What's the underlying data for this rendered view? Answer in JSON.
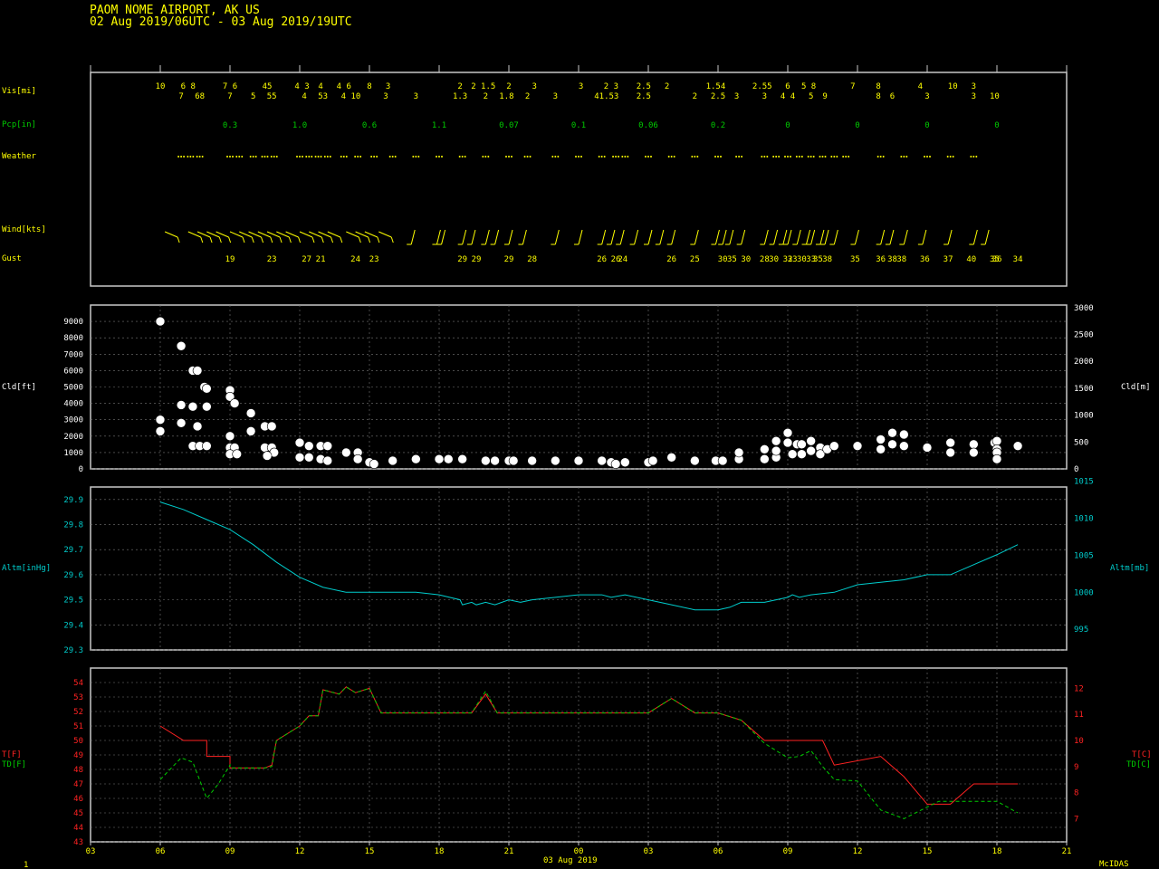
{
  "header": {
    "title": "PAOM  NOME AIRPORT, AK US",
    "subtitle": "02 Aug 2019/06UTC - 03 Aug 2019/19UTC"
  },
  "footer": {
    "page": "1",
    "brand": "McIDAS",
    "date_label": "03 Aug 2019"
  },
  "colors": {
    "yellow": "#ffff00",
    "green": "#00cc00",
    "cyan": "#00cccc",
    "red": "#ff2222",
    "white": "#ffffff",
    "grid": "#777777",
    "frame": "#c8c8c8"
  },
  "labels": {
    "vis": "Vis[mi]",
    "pcp": "Pcp[in]",
    "weather": "Weather",
    "wind": "Wind[kts]",
    "gust": "Gust",
    "cld_ft": "Cld[ft]",
    "cld_m": "Cld[m]",
    "altm_inhg": "Altm[inHg]",
    "altm_mb": "Altm[mb]",
    "t_f": "T[F]",
    "td_f": "TD[F]",
    "t_c": "T[C]",
    "td_c": "TD[C]"
  },
  "chart_data": {
    "type": "line",
    "x_unit": "hours since 02 Aug 2019 03UTC",
    "x_range": [
      0,
      42
    ],
    "x_ticks": [
      "03",
      "06",
      "09",
      "12",
      "15",
      "18",
      "21",
      "00",
      "03",
      "06",
      "09",
      "12",
      "15",
      "18",
      "21"
    ],
    "vis_top": [
      {
        "t": 3,
        "v": "10"
      },
      {
        "t": 4.2,
        "v": "6 8"
      },
      {
        "t": 6.0,
        "v": "7 6"
      },
      {
        "t": 7.6,
        "v": "45"
      },
      {
        "t": 9.1,
        "v": "4 3"
      },
      {
        "t": 9.9,
        "v": "4"
      },
      {
        "t": 10.9,
        "v": "4 6"
      },
      {
        "t": 12.0,
        "v": "8"
      },
      {
        "t": 12.8,
        "v": "3"
      },
      {
        "t": 15.9,
        "v": "2"
      },
      {
        "t": 16.9,
        "v": "2 1.5"
      },
      {
        "t": 18.0,
        "v": "2"
      },
      {
        "t": 19.1,
        "v": "3"
      },
      {
        "t": 21.1,
        "v": "3"
      },
      {
        "t": 22.4,
        "v": "2 3"
      },
      {
        "t": 23.8,
        "v": "2.5"
      },
      {
        "t": 24.8,
        "v": "2"
      },
      {
        "t": 26.9,
        "v": "1.54"
      },
      {
        "t": 28.9,
        "v": "2.55"
      },
      {
        "t": 30.0,
        "v": "6"
      },
      {
        "t": 30.9,
        "v": "5 8"
      },
      {
        "t": 32.8,
        "v": "7"
      },
      {
        "t": 33.9,
        "v": "8"
      },
      {
        "t": 35.7,
        "v": "4"
      },
      {
        "t": 37.1,
        "v": "10"
      },
      {
        "t": 38.0,
        "v": "3"
      }
    ],
    "vis_bottom": [
      {
        "t": 3.9,
        "v": "7"
      },
      {
        "t": 4.7,
        "v": "68"
      },
      {
        "t": 6.0,
        "v": "7"
      },
      {
        "t": 7.0,
        "v": "5"
      },
      {
        "t": 7.8,
        "v": "55"
      },
      {
        "t": 9.2,
        "v": "4"
      },
      {
        "t": 10.0,
        "v": "53"
      },
      {
        "t": 11.2,
        "v": "4 10"
      },
      {
        "t": 12.7,
        "v": "3"
      },
      {
        "t": 14.0,
        "v": "3"
      },
      {
        "t": 15.9,
        "v": "1.3"
      },
      {
        "t": 17.0,
        "v": "2"
      },
      {
        "t": 17.9,
        "v": "1.8"
      },
      {
        "t": 18.8,
        "v": "2"
      },
      {
        "t": 20.0,
        "v": "3"
      },
      {
        "t": 22.2,
        "v": "41.53"
      },
      {
        "t": 23.8,
        "v": "2.5"
      },
      {
        "t": 26.0,
        "v": "2"
      },
      {
        "t": 27.0,
        "v": "2.5"
      },
      {
        "t": 27.8,
        "v": "3"
      },
      {
        "t": 29.0,
        "v": "3"
      },
      {
        "t": 30.0,
        "v": "4 4"
      },
      {
        "t": 31.0,
        "v": "5"
      },
      {
        "t": 31.6,
        "v": "9"
      },
      {
        "t": 33.9,
        "v": "8"
      },
      {
        "t": 34.5,
        "v": "6"
      },
      {
        "t": 36.0,
        "v": "3"
      },
      {
        "t": 38.0,
        "v": "3"
      },
      {
        "t": 38.9,
        "v": "10"
      }
    ],
    "precip": [
      {
        "t": 6.0,
        "v": "0.3"
      },
      {
        "t": 9.0,
        "v": "1.0"
      },
      {
        "t": 12.0,
        "v": "0.6"
      },
      {
        "t": 15.0,
        "v": "1.1"
      },
      {
        "t": 18.0,
        "v": "0.07"
      },
      {
        "t": 21.0,
        "v": "0.1"
      },
      {
        "t": 24.0,
        "v": "0.06"
      },
      {
        "t": 27.0,
        "v": "0.2"
      },
      {
        "t": 30.0,
        "v": "0"
      },
      {
        "t": 33.0,
        "v": "0"
      },
      {
        "t": 36.0,
        "v": "0"
      },
      {
        "t": 39.0,
        "v": "0"
      }
    ],
    "weather_times": [
      3.9,
      4.3,
      4.7,
      6.0,
      6.4,
      7.0,
      7.5,
      7.9,
      9.0,
      9.4,
      9.8,
      10.2,
      10.9,
      11.5,
      12.2,
      13.0,
      14.0,
      15.0,
      16.0,
      17.0,
      18.0,
      18.8,
      20.0,
      21.0,
      22.0,
      22.6,
      23.0,
      24.0,
      25.0,
      26.0,
      27.0,
      27.9,
      29.0,
      29.5,
      30.0,
      30.5,
      31.0,
      31.5,
      32.0,
      32.5,
      34.0,
      35.0,
      36.0,
      37.0,
      38.0
    ],
    "wind_times": [
      3.2,
      4.2,
      4.6,
      5.0,
      5.4,
      6.0,
      6.4,
      6.8,
      7.2,
      7.6,
      8.0,
      8.4,
      9.0,
      9.4,
      9.8,
      10.2,
      11.0,
      11.4,
      11.8,
      12.4,
      13.8,
      14.9,
      15.1,
      16.0,
      16.4,
      17.0,
      17.4,
      18.0,
      18.6,
      20.0,
      21.0,
      22.0,
      22.4,
      22.8,
      23.4,
      24.0,
      24.5,
      25.0,
      26.0,
      26.9,
      27.2,
      27.5,
      28.0,
      29.0,
      29.4,
      29.8,
      30.0,
      30.4,
      30.8,
      31.0,
      31.4,
      31.6,
      32.0,
      32.9,
      34.0,
      34.4,
      35.0,
      35.8,
      36.9,
      38.0,
      38.5
    ],
    "gust": [
      {
        "t": 6.0,
        "v": "19"
      },
      {
        "t": 7.8,
        "v": "23"
      },
      {
        "t": 9.3,
        "v": "27"
      },
      {
        "t": 9.9,
        "v": "21"
      },
      {
        "t": 11.4,
        "v": "24"
      },
      {
        "t": 12.2,
        "v": "23"
      },
      {
        "t": 16.0,
        "v": "29"
      },
      {
        "t": 16.6,
        "v": "29"
      },
      {
        "t": 18.0,
        "v": "29"
      },
      {
        "t": 19.0,
        "v": "28"
      },
      {
        "t": 22.0,
        "v": "26"
      },
      {
        "t": 22.6,
        "v": "26"
      },
      {
        "t": 22.9,
        "v": "24"
      },
      {
        "t": 25.0,
        "v": "26"
      },
      {
        "t": 26.0,
        "v": "25"
      },
      {
        "t": 27.2,
        "v": "30"
      },
      {
        "t": 27.6,
        "v": "35"
      },
      {
        "t": 28.2,
        "v": "30"
      },
      {
        "t": 29.0,
        "v": "28"
      },
      {
        "t": 29.4,
        "v": "30"
      },
      {
        "t": 30.0,
        "v": "32"
      },
      {
        "t": 30.2,
        "v": "33"
      },
      {
        "t": 30.6,
        "v": "30"
      },
      {
        "t": 31.0,
        "v": "33"
      },
      {
        "t": 31.3,
        "v": "35"
      },
      {
        "t": 31.7,
        "v": "38"
      },
      {
        "t": 32.9,
        "v": "35"
      },
      {
        "t": 34.0,
        "v": "36"
      },
      {
        "t": 34.5,
        "v": "38"
      },
      {
        "t": 34.9,
        "v": "38"
      },
      {
        "t": 35.9,
        "v": "36"
      },
      {
        "t": 36.9,
        "v": "37"
      },
      {
        "t": 37.9,
        "v": "40"
      },
      {
        "t": 38.9,
        "v": "35"
      },
      {
        "t": 39.0,
        "v": "36"
      },
      {
        "t": 39.9,
        "v": "34"
      }
    ],
    "cloud": {
      "y_range_ft": [
        0,
        10000
      ],
      "y_ticks_ft": [
        0,
        1000,
        2000,
        3000,
        4000,
        5000,
        6000,
        7000,
        8000,
        9000
      ],
      "y_ticks_m": [
        0,
        500,
        1000,
        1500,
        2000,
        2500,
        3000
      ],
      "points": [
        {
          "t": 3.0,
          "v": 9000
        },
        {
          "t": 3.0,
          "v": 3000
        },
        {
          "t": 3.0,
          "v": 2300
        },
        {
          "t": 3.9,
          "v": 7500
        },
        {
          "t": 3.9,
          "v": 3900
        },
        {
          "t": 3.9,
          "v": 2800
        },
        {
          "t": 4.4,
          "v": 6000
        },
        {
          "t": 4.6,
          "v": 6000
        },
        {
          "t": 4.4,
          "v": 3800
        },
        {
          "t": 4.6,
          "v": 2600
        },
        {
          "t": 4.4,
          "v": 1400
        },
        {
          "t": 4.7,
          "v": 1400
        },
        {
          "t": 4.9,
          "v": 5000
        },
        {
          "t": 5.0,
          "v": 4900
        },
        {
          "t": 5.0,
          "v": 3800
        },
        {
          "t": 5.0,
          "v": 1400
        },
        {
          "t": 6.0,
          "v": 4800
        },
        {
          "t": 6.0,
          "v": 4400
        },
        {
          "t": 6.0,
          "v": 2000
        },
        {
          "t": 6.0,
          "v": 1300
        },
        {
          "t": 6.2,
          "v": 4000
        },
        {
          "t": 6.2,
          "v": 1300
        },
        {
          "t": 6.0,
          "v": 900
        },
        {
          "t": 6.3,
          "v": 900
        },
        {
          "t": 6.9,
          "v": 3400
        },
        {
          "t": 6.9,
          "v": 2300
        },
        {
          "t": 7.5,
          "v": 2600
        },
        {
          "t": 7.8,
          "v": 2600
        },
        {
          "t": 7.5,
          "v": 1300
        },
        {
          "t": 7.8,
          "v": 1300
        },
        {
          "t": 7.9,
          "v": 1000
        },
        {
          "t": 7.6,
          "v": 800
        },
        {
          "t": 9.0,
          "v": 1600
        },
        {
          "t": 9.0,
          "v": 700
        },
        {
          "t": 9.4,
          "v": 1400
        },
        {
          "t": 9.4,
          "v": 700
        },
        {
          "t": 9.9,
          "v": 1400
        },
        {
          "t": 10.2,
          "v": 1400
        },
        {
          "t": 9.9,
          "v": 600
        },
        {
          "t": 10.2,
          "v": 500
        },
        {
          "t": 11.0,
          "v": 1000
        },
        {
          "t": 11.5,
          "v": 1000
        },
        {
          "t": 11.5,
          "v": 600
        },
        {
          "t": 12.0,
          "v": 400
        },
        {
          "t": 12.2,
          "v": 300
        },
        {
          "t": 13.0,
          "v": 500
        },
        {
          "t": 14.0,
          "v": 600
        },
        {
          "t": 15.0,
          "v": 600
        },
        {
          "t": 15.4,
          "v": 600
        },
        {
          "t": 16.0,
          "v": 600
        },
        {
          "t": 17.0,
          "v": 500
        },
        {
          "t": 17.4,
          "v": 500
        },
        {
          "t": 18.0,
          "v": 500
        },
        {
          "t": 18.2,
          "v": 500
        },
        {
          "t": 19.0,
          "v": 500
        },
        {
          "t": 20.0,
          "v": 500
        },
        {
          "t": 21.0,
          "v": 500
        },
        {
          "t": 22.0,
          "v": 500
        },
        {
          "t": 22.4,
          "v": 400
        },
        {
          "t": 22.6,
          "v": 300
        },
        {
          "t": 23.0,
          "v": 400
        },
        {
          "t": 24.0,
          "v": 400
        },
        {
          "t": 24.2,
          "v": 500
        },
        {
          "t": 25.0,
          "v": 700
        },
        {
          "t": 26.0,
          "v": 500
        },
        {
          "t": 26.9,
          "v": 500
        },
        {
          "t": 27.2,
          "v": 500
        },
        {
          "t": 27.9,
          "v": 600
        },
        {
          "t": 27.9,
          "v": 1000
        },
        {
          "t": 29.0,
          "v": 1200
        },
        {
          "t": 29.0,
          "v": 600
        },
        {
          "t": 29.5,
          "v": 1700
        },
        {
          "t": 29.5,
          "v": 700
        },
        {
          "t": 29.5,
          "v": 1100
        },
        {
          "t": 30.0,
          "v": 2200
        },
        {
          "t": 30.0,
          "v": 1600
        },
        {
          "t": 30.2,
          "v": 900
        },
        {
          "t": 30.4,
          "v": 1500
        },
        {
          "t": 30.6,
          "v": 1500
        },
        {
          "t": 30.6,
          "v": 900
        },
        {
          "t": 31.0,
          "v": 1700
        },
        {
          "t": 31.0,
          "v": 1100
        },
        {
          "t": 31.4,
          "v": 1300
        },
        {
          "t": 31.4,
          "v": 900
        },
        {
          "t": 31.7,
          "v": 1200
        },
        {
          "t": 32.0,
          "v": 1400
        },
        {
          "t": 33.0,
          "v": 1400
        },
        {
          "t": 34.0,
          "v": 1800
        },
        {
          "t": 34.0,
          "v": 1200
        },
        {
          "t": 34.5,
          "v": 2200
        },
        {
          "t": 34.5,
          "v": 1500
        },
        {
          "t": 35.0,
          "v": 2100
        },
        {
          "t": 35.0,
          "v": 1400
        },
        {
          "t": 36.0,
          "v": 1300
        },
        {
          "t": 37.0,
          "v": 1600
        },
        {
          "t": 37.0,
          "v": 1000
        },
        {
          "t": 38.0,
          "v": 1500
        },
        {
          "t": 38.0,
          "v": 1000
        },
        {
          "t": 38.9,
          "v": 1600
        },
        {
          "t": 39.0,
          "v": 1700
        },
        {
          "t": 39.0,
          "v": 1200
        },
        {
          "t": 39.0,
          "v": 1000
        },
        {
          "t": 39.0,
          "v": 600
        },
        {
          "t": 39.9,
          "v": 1400
        }
      ]
    },
    "altimeter": {
      "y_range_inhg": [
        29.3,
        29.95
      ],
      "y_ticks_inhg": [
        "29.3",
        "29.4",
        "29.5",
        "29.6",
        "29.7",
        "29.8",
        "29.9"
      ],
      "y_ticks_mb": [
        "995",
        "1000",
        "1005",
        "1010",
        "1015"
      ],
      "t": [
        3,
        4,
        5,
        6,
        7,
        8,
        9,
        10,
        11,
        12,
        13,
        14,
        15,
        15.9,
        16.0,
        16.4,
        16.6,
        17.0,
        17.4,
        18.0,
        18.5,
        19,
        20,
        21,
        22,
        22.4,
        23,
        24,
        25,
        26,
        27,
        27.5,
        28,
        29,
        29.5,
        30,
        30.2,
        30.5,
        31,
        32,
        33,
        34,
        35,
        36,
        37,
        38,
        39,
        39.9
      ],
      "v": [
        29.89,
        29.86,
        29.82,
        29.78,
        29.72,
        29.65,
        29.59,
        29.55,
        29.53,
        29.53,
        29.53,
        29.53,
        29.52,
        29.5,
        29.48,
        29.49,
        29.48,
        29.49,
        29.48,
        29.5,
        29.49,
        29.5,
        29.51,
        29.52,
        29.52,
        29.51,
        29.52,
        29.5,
        29.48,
        29.46,
        29.46,
        29.47,
        29.49,
        29.49,
        29.5,
        29.51,
        29.52,
        29.51,
        29.52,
        29.53,
        29.56,
        29.57,
        29.58,
        29.6,
        29.6,
        29.64,
        29.68,
        29.72
      ]
    },
    "temperature": {
      "y_range_f": [
        43,
        55
      ],
      "y_ticks_f": [
        "43",
        "44",
        "45",
        "46",
        "47",
        "48",
        "49",
        "50",
        "51",
        "52",
        "53",
        "54"
      ],
      "y_ticks_c": [
        "7",
        "8",
        "9",
        "10",
        "11",
        "12"
      ],
      "t": [
        3.0,
        4.0,
        4.7,
        5.0,
        5.0,
        6.0,
        6.0,
        7.5,
        7.8,
        8.0,
        9.0,
        9.4,
        9.8,
        10.0,
        10.7,
        11.0,
        11.4,
        12.0,
        12.5,
        14.0,
        15.0,
        15.5,
        16.0,
        16.4,
        17.0,
        17.5,
        18.0,
        18.5,
        20.0,
        21.0,
        22.0,
        22.6,
        24.0,
        25.0,
        26.0,
        27.0,
        28.0,
        29.0,
        30.0,
        31.0,
        31.5,
        32.0,
        34.0,
        35.0,
        36.0,
        36.5,
        37.0,
        38.0,
        39.0,
        39.9
      ],
      "v": [
        51,
        50,
        50,
        50,
        48.9,
        48.9,
        48.1,
        48.1,
        48.3,
        50,
        51,
        51.7,
        51.7,
        53.5,
        53.2,
        53.7,
        53.3,
        53.6,
        51.9,
        51.9,
        51.9,
        51.9,
        51.9,
        51.9,
        53.2,
        51.9,
        51.9,
        51.9,
        51.9,
        51.9,
        51.9,
        51.9,
        51.9,
        52.9,
        51.9,
        51.9,
        51.4,
        50,
        50,
        50,
        50,
        48.3,
        48.9,
        47.5,
        45.6,
        45.6,
        45.6,
        47,
        47,
        47,
        45.6,
        48
      ],
      "dew_t": [
        3.0,
        3.9,
        4.4,
        5.0,
        5.5,
        6.0,
        6.0,
        7.5,
        7.8,
        8.0,
        9.0,
        9.4,
        9.8,
        10.0,
        10.7,
        11.0,
        11.4,
        12.0,
        12.5,
        14.0,
        15.0,
        16.0,
        16.4,
        17.0,
        17.5,
        18.0,
        20.0,
        22.0,
        22.6,
        24.0,
        25.0,
        26.0,
        27.0,
        28.0,
        29.0,
        30.0,
        30.5,
        31.0,
        31.5,
        32.0,
        33.0,
        34.0,
        35.0,
        36.0,
        36.5,
        37.0,
        38.0,
        39.0,
        39.9
      ],
      "dew_v": [
        47.3,
        48.8,
        48.5,
        46.0,
        47.0,
        48.3,
        48.1,
        48.1,
        48.2,
        50,
        51,
        51.7,
        51.7,
        53.5,
        53.2,
        53.7,
        53.3,
        53.6,
        51.9,
        51.9,
        51.9,
        51.9,
        51.9,
        53.4,
        51.9,
        51.9,
        51.9,
        51.9,
        51.9,
        51.9,
        52.9,
        51.9,
        51.9,
        51.4,
        49.8,
        48.8,
        48.9,
        49.3,
        48.2,
        47.3,
        47.2,
        45.2,
        44.6,
        45.4,
        45.8,
        45.8,
        45.8,
        45.8,
        45.0
      ]
    }
  }
}
